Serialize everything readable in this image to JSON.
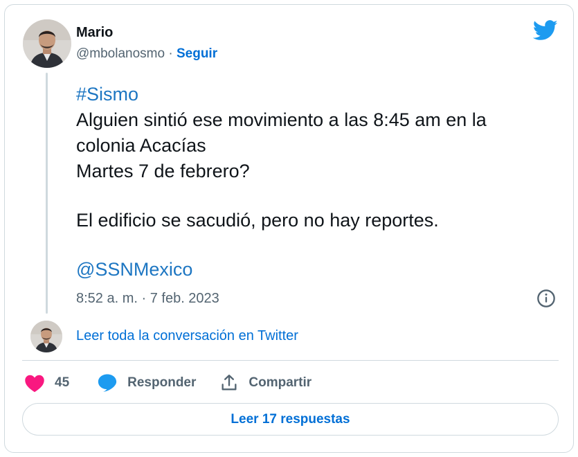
{
  "author": {
    "name": "Mario",
    "handle": "@mbolanosmo",
    "separator": " · ",
    "follow_label": "Seguir"
  },
  "tweet": {
    "hashtag": "#Sismo",
    "lines": [
      "Alguien sintió ese movimiento a las 8:45 am en la",
      "colonia Acacías",
      "Martes 7 de febrero?"
    ],
    "paragraph2": "El edificio se sacudió, pero no hay reportes.",
    "mention": "@SSNMexico",
    "timestamp": "8:52 a. m. · 7 feb. 2023"
  },
  "conversation_link": "Leer toda la conversación en Twitter",
  "actions": {
    "like_count": "45",
    "reply_label": "Responder",
    "share_label": "Compartir"
  },
  "replies_button": "Leer 17 respuestas",
  "colors": {
    "accent": "#006fd6",
    "twitter_blue": "#1d9bf0",
    "heart": "#f91880",
    "secondary_text": "#536471",
    "border": "#cfd9de"
  },
  "icons": {
    "twitter": "twitter-bird-icon",
    "info": "info-icon",
    "like": "heart-icon",
    "reply": "speech-bubble-icon",
    "share": "share-upload-icon"
  }
}
